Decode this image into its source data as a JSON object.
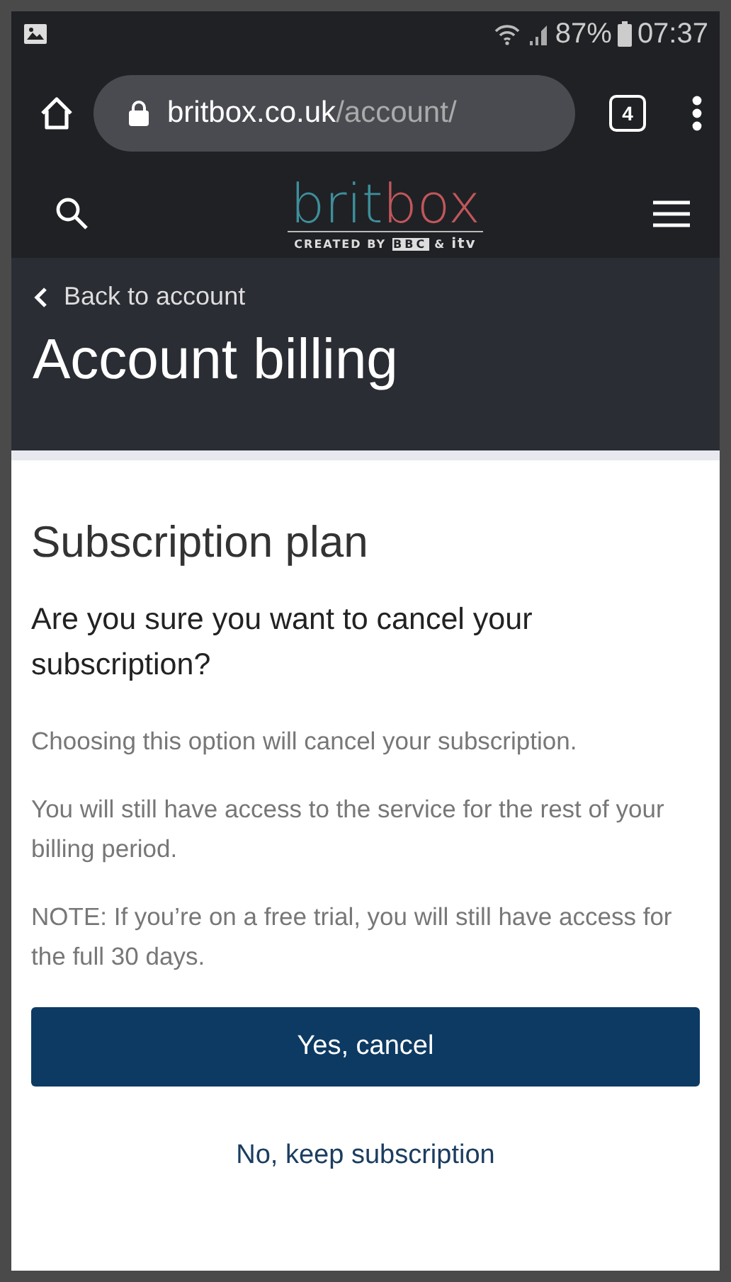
{
  "status_bar": {
    "battery": "87%",
    "time": "07:37"
  },
  "browser": {
    "url_host": "britbox.co.uk",
    "url_path": "/account/",
    "tab_count": "4"
  },
  "site_header": {
    "logo": {
      "brit": "brit",
      "box": "box",
      "tagline": "CREATED BY",
      "bbc": "BBC",
      "amp": "&",
      "itv": "itv"
    }
  },
  "hero": {
    "back_link": "Back to account",
    "title": "Account billing"
  },
  "content": {
    "heading": "Subscription plan",
    "question": "Are you sure you want to cancel your subscription?",
    "paragraphs": [
      "Choosing this option will cancel your subscription.",
      "You will still have access to the service for the rest of your billing period.",
      "NOTE: If you’re on a free trial, you will still have access for the full 30 days."
    ],
    "primary_button": "Yes, cancel",
    "secondary_link": "No, keep subscription"
  }
}
